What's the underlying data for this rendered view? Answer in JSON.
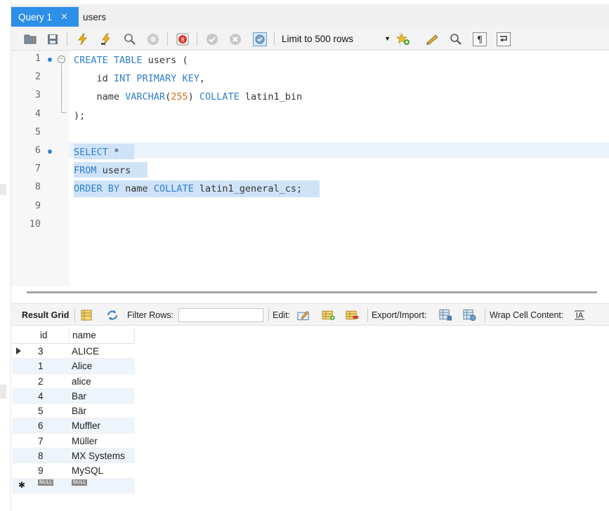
{
  "tabs": [
    {
      "label": "Query 1",
      "active": true
    },
    {
      "label": "users",
      "active": false
    }
  ],
  "toolbar": {
    "limit_select": "Limit to 500 rows",
    "icons": [
      "open-folder-icon",
      "save-icon",
      "execute-icon",
      "execute-current-icon",
      "explain-icon",
      "stop-icon",
      "toggle-error-icon",
      "commit-icon",
      "rollback-icon",
      "autocommit-icon",
      "bookmark-icon",
      "beautify-icon",
      "find-icon",
      "invisible-chars-icon",
      "wrap-icon"
    ]
  },
  "editor": {
    "line_numbers": [
      "1",
      "2",
      "3",
      "4",
      "5",
      "6",
      "7",
      "8",
      "9",
      "10"
    ],
    "lines": [
      {
        "parts": [
          {
            "t": "CREATE TABLE",
            "c": "kw"
          },
          {
            "t": " users (",
            "c": ""
          }
        ]
      },
      {
        "parts": [
          {
            "t": "    id ",
            "c": ""
          },
          {
            "t": "INT PRIMARY KEY",
            "c": "kw"
          },
          {
            "t": ",",
            "c": ""
          }
        ]
      },
      {
        "parts": [
          {
            "t": "    name ",
            "c": ""
          },
          {
            "t": "VARCHAR",
            "c": "kw"
          },
          {
            "t": "(",
            "c": ""
          },
          {
            "t": "255",
            "c": "num"
          },
          {
            "t": ") ",
            "c": ""
          },
          {
            "t": "COLLATE",
            "c": "kw"
          },
          {
            "t": " latin1_bin",
            "c": ""
          }
        ]
      },
      {
        "parts": [
          {
            "t": ");",
            "c": ""
          }
        ]
      },
      {
        "parts": []
      },
      {
        "parts": [
          {
            "t": "SELECT",
            "c": "kw"
          },
          {
            "t": " *",
            "c": ""
          }
        ]
      },
      {
        "parts": [
          {
            "t": "FROM",
            "c": "kw"
          },
          {
            "t": " users",
            "c": ""
          }
        ]
      },
      {
        "parts": [
          {
            "t": "ORDER BY",
            "c": "kw"
          },
          {
            "t": " name ",
            "c": ""
          },
          {
            "t": "COLLATE",
            "c": "kw"
          },
          {
            "t": " latin1_general_cs;",
            "c": ""
          }
        ]
      },
      {
        "parts": []
      },
      {
        "parts": []
      }
    ]
  },
  "result_toolbar": {
    "result_grid": "Result Grid",
    "filter_rows": "Filter Rows:",
    "filter_value": "",
    "edit": "Edit:",
    "export_import": "Export/Import:",
    "wrap_cell": "Wrap Cell Content:"
  },
  "grid": {
    "columns": [
      "id",
      "name"
    ],
    "rows": [
      {
        "id": "3",
        "name": "ALICE"
      },
      {
        "id": "1",
        "name": "Alice"
      },
      {
        "id": "2",
        "name": "alice"
      },
      {
        "id": "4",
        "name": "Bar"
      },
      {
        "id": "5",
        "name": "Bär"
      },
      {
        "id": "6",
        "name": "Muffler"
      },
      {
        "id": "7",
        "name": "Müller"
      },
      {
        "id": "8",
        "name": "MX Systems"
      },
      {
        "id": "9",
        "name": "MySQL"
      }
    ],
    "null_label": "NULL"
  },
  "colors": {
    "accent": "#2d8fe6",
    "keyword": "#2f7fd0",
    "number": "#cf6f1a",
    "selection": "#cfe3f8"
  }
}
